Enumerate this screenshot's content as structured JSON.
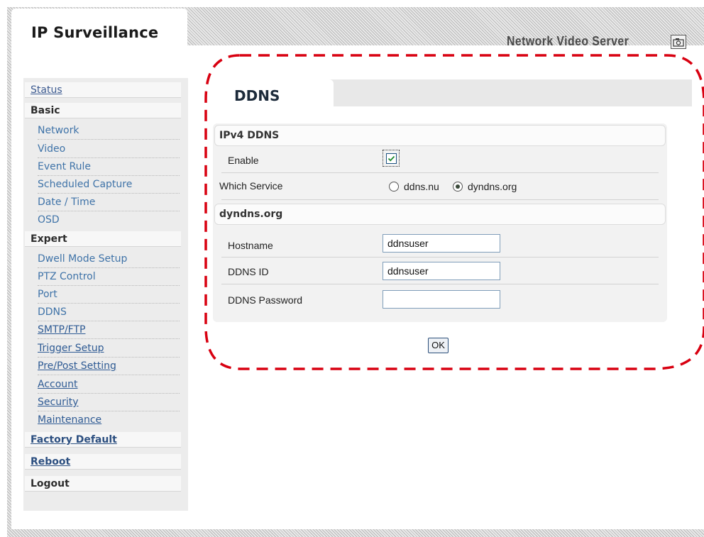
{
  "header": {
    "brand": "IP Surveillance",
    "product": "Network Video Server",
    "camera_button_icon": "camera-icon"
  },
  "sidebar": {
    "status": "Status",
    "basic": {
      "heading": "Basic",
      "items": [
        "Network",
        "Video",
        "Event Rule",
        "Scheduled Capture",
        "Date / Time",
        "OSD"
      ]
    },
    "expert": {
      "heading": "Expert",
      "items": [
        "Dwell Mode Setup",
        "PTZ Control",
        "Port",
        "DDNS",
        "SMTP/FTP",
        "Trigger Setup",
        "Pre/Post Setting",
        "Account",
        "Security",
        "Maintenance"
      ]
    },
    "factory_default": "Factory Default",
    "reboot": "Reboot",
    "logout": "Logout"
  },
  "main": {
    "tab_title": "DDNS",
    "ipv4_section": {
      "heading": "IPv4 DDNS",
      "enable_label": "Enable",
      "enable_checked": true,
      "service_label": "Which Service",
      "service_options": [
        "ddns.nu",
        "dyndns.org"
      ],
      "service_selected": "dyndns.org"
    },
    "dyndns_section": {
      "heading": "dyndns.org",
      "hostname_label": "Hostname",
      "hostname_value": "ddnsuser",
      "ddns_id_label": "DDNS ID",
      "ddns_id_value": "ddnsuser",
      "password_label": "DDNS Password",
      "password_value": ""
    },
    "ok_label": "OK"
  },
  "colors": {
    "annotation": "#d80010",
    "link": "#3f73a8",
    "sidebar_bg": "#ececec"
  }
}
